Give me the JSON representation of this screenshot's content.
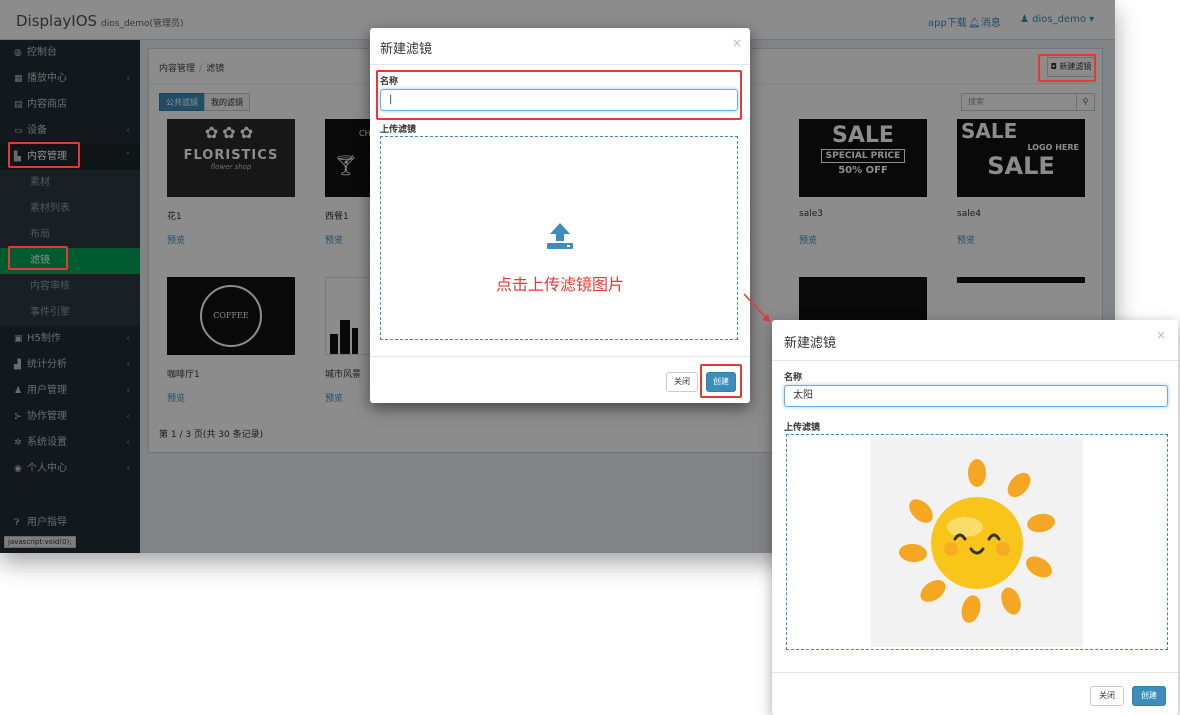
{
  "app": {
    "title": "DisplayIOS",
    "user_role": "dios_demo(管理员)"
  },
  "topnav": {
    "download": "app下载",
    "messages": "消息",
    "user": "dios_demo"
  },
  "sidebar": {
    "items": [
      {
        "label": "控制台",
        "icon": "dashboard-icon"
      },
      {
        "label": "播放中心",
        "icon": "grid-icon"
      },
      {
        "label": "内容商店",
        "icon": "store-icon"
      },
      {
        "label": "设备",
        "icon": "monitor-icon"
      },
      {
        "label": "内容管理",
        "icon": "content-icon"
      },
      {
        "label": "素材"
      },
      {
        "label": "素材列表"
      },
      {
        "label": "布局"
      },
      {
        "label": "滤镜"
      },
      {
        "label": "内容审核"
      },
      {
        "label": "事件引擎"
      },
      {
        "label": "H5制作",
        "icon": "h5-icon"
      },
      {
        "label": "统计分析",
        "icon": "chart-icon"
      },
      {
        "label": "用户管理",
        "icon": "users-icon"
      },
      {
        "label": "协作管理",
        "icon": "share-icon"
      },
      {
        "label": "系统设置",
        "icon": "gear-icon"
      },
      {
        "label": "个人中心",
        "icon": "person-icon"
      },
      {
        "label": "用户指导",
        "icon": "help-icon"
      }
    ]
  },
  "breadcrumb": {
    "root": "内容管理",
    "current": "滤镜"
  },
  "new_filter_button": "新建滤镜",
  "tabs": [
    "公共滤镜",
    "我的滤镜"
  ],
  "search": {
    "placeholder": "搜索"
  },
  "cards": [
    {
      "name": "花1",
      "preview": "预览",
      "art": "FLORISTICS",
      "art_sub": "flower shop"
    },
    {
      "name": "西餐1",
      "preview": "预览",
      "art": "CH"
    },
    {
      "name": "sale3",
      "preview": "预览",
      "art": "SALE",
      "art_sub": "SPECIAL PRICE",
      "art_sub2": "50% OFF"
    },
    {
      "name": "sale4",
      "preview": "预览",
      "art": "SALE",
      "art_sub": "LOGO HERE"
    },
    {
      "name": "咖啡厅1",
      "preview": "预览",
      "art": "COFFEE SHOP"
    },
    {
      "name": "城市风景",
      "preview": "预览"
    }
  ],
  "pager": "第 1 / 3 页(共 30 条记录)",
  "status_bar": "javascript:void(0);",
  "modal1": {
    "title": "新建滤镜",
    "name_label": "名称",
    "name_value": "|",
    "upload_label": "上传滤镜",
    "upload_hint": "点击上传滤镜图片",
    "close_label": "关闭",
    "create_label": "创建"
  },
  "modal2": {
    "title": "新建滤镜",
    "name_label": "名称",
    "name_value": "太阳",
    "upload_label": "上传滤镜",
    "close_label": "关闭",
    "create_label": "创建"
  },
  "colors": {
    "accent": "#3c8dbc",
    "highlight": "#e53935",
    "sidebar": "#222d32",
    "active": "#00a65a",
    "sun": "#f9c51b",
    "sun_ray": "#f5a623"
  }
}
